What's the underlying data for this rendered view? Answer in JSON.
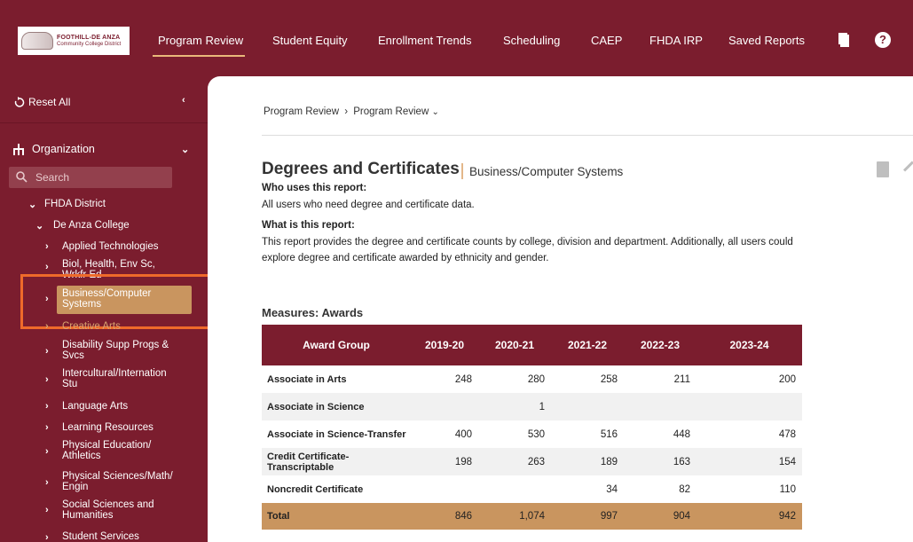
{
  "logo": {
    "line1": "FOOTHILL-DE ANZA",
    "line2": "Community College District"
  },
  "nav": [
    {
      "label": "Program Review",
      "active": true
    },
    {
      "label": "Student Equity"
    },
    {
      "label": "Enrollment Trends"
    },
    {
      "label": "Scheduling"
    },
    {
      "label": "CAEP"
    },
    {
      "label": "FHDA IRP"
    },
    {
      "label": "Saved Reports"
    }
  ],
  "help_glyph": "?",
  "sidebar": {
    "reset_label": "Reset All",
    "organization_label": "Organization",
    "search_placeholder": "Search",
    "tree": {
      "district": "FHDA District",
      "college": "De Anza College",
      "items": [
        {
          "label": "Applied Technologies"
        },
        {
          "label": "Biol, Health, Env Sc, Wrkfr Ed"
        },
        {
          "label": "Business/Computer Systems",
          "selected": true
        },
        {
          "label": "Creative Arts"
        },
        {
          "label": "Disability Supp Progs & Svcs"
        },
        {
          "label": "Intercultural/Internation Stu"
        },
        {
          "label": "Language Arts"
        },
        {
          "label": "Learning Resources"
        },
        {
          "label": "Physical Education/ Athletics"
        },
        {
          "label": "Physical Sciences/Math/ Engin"
        },
        {
          "label": "Social Sciences and Humanities"
        },
        {
          "label": "Student Services"
        }
      ]
    }
  },
  "breadcrumb": {
    "root": "Program Review",
    "sep": "›",
    "current": "Program Review"
  },
  "report": {
    "title": "Degrees and Certificates",
    "subtitle": "Business/Computer Systems",
    "who_heading": "Who uses this report:",
    "who_text": "All users who need degree and certificate data.",
    "what_heading": "What is this report:",
    "what_text": "This report provides the degree and certificate counts by college, division and department. Additionally, all users could explore degree and certificate awarded by ethnicity and gender."
  },
  "measures_title": "Measures: Awards",
  "table": {
    "headers": [
      "Award Group",
      "2019-20",
      "2020-21",
      "2021-22",
      "2022-23",
      "2023-24"
    ],
    "rows": [
      [
        "Associate in Arts",
        "248",
        "280",
        "258",
        "211",
        "200"
      ],
      [
        "Associate in Science",
        "",
        "1",
        "",
        "",
        ""
      ],
      [
        "Associate in Science-Transfer",
        "400",
        "530",
        "516",
        "448",
        "478"
      ],
      [
        "Credit Certificate-Transcriptable",
        "198",
        "263",
        "189",
        "163",
        "154"
      ],
      [
        "Noncredit Certificate",
        "",
        "",
        "34",
        "82",
        "110"
      ]
    ],
    "total": [
      "Total",
      "846",
      "1,074",
      "997",
      "904",
      "942"
    ]
  },
  "colors": {
    "brand": "#7b1d2e",
    "accent": "#c9955f",
    "highlight_box": "#ef6a2a"
  }
}
